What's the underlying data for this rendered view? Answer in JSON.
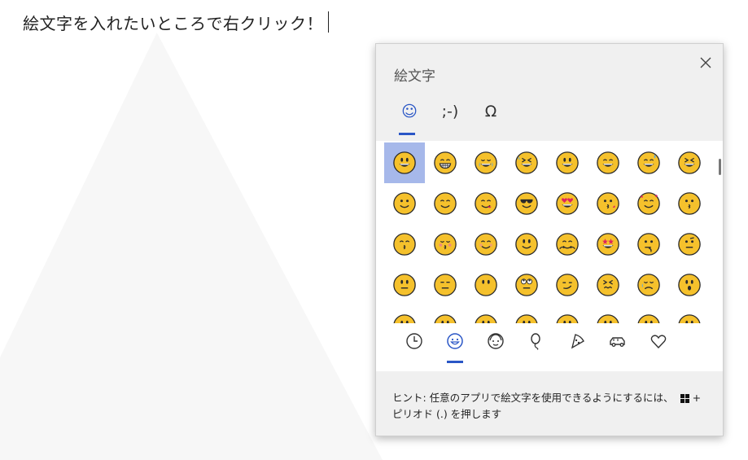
{
  "editor": {
    "text": "絵文字を入れたいところで右クリック！"
  },
  "panel": {
    "title": "絵文字",
    "close_icon": "close-icon",
    "tabs": [
      {
        "id": "emoji",
        "icon": "smiley-tab-icon",
        "label": "☺",
        "active": true
      },
      {
        "id": "kaomoji",
        "icon": "kaomoji-tab-icon",
        "label": ";-)",
        "active": false
      },
      {
        "id": "symbols",
        "icon": "omega-tab-icon",
        "label": "Ω",
        "active": false
      }
    ],
    "emoji_rows": [
      [
        "grinning-face",
        "beaming-face",
        "tears-of-joy-face",
        "rolling-laughing-face",
        "grinning-big-eyes-face",
        "grinning-smiling-eyes-face",
        "sweat-smile-face",
        "squinting-laugh-face"
      ],
      [
        "winking-face",
        "smiling-face",
        "savoring-food-face",
        "sunglasses-face",
        "heart-eyes-face",
        "blowing-kiss-face",
        "hearts-face",
        "kissing-face"
      ],
      [
        "kissing-smiling-eyes-face",
        "kissing-closed-eyes-face",
        "relaxed-face",
        "slightly-smiling-face",
        "hugging-face",
        "star-struck-face",
        "thinking-face",
        "raised-eyebrow-face"
      ],
      [
        "neutral-face",
        "expressionless-face",
        "no-mouth-face",
        "rolling-eyes-face",
        "smirking-face",
        "persevering-face",
        "sad-sweat-face",
        "open-mouth-face"
      ],
      [
        "face-row5-1",
        "face-row5-2",
        "face-row5-3",
        "face-row5-4",
        "face-row5-5",
        "face-row5-6",
        "face-row5-7",
        "face-row5-8"
      ]
    ],
    "selected_emoji": "grinning-face",
    "categories": [
      {
        "id": "recent",
        "icon": "clock-icon",
        "active": false
      },
      {
        "id": "smileys",
        "icon": "smiley-category-icon",
        "active": true
      },
      {
        "id": "people",
        "icon": "person-icon",
        "active": false
      },
      {
        "id": "celebration",
        "icon": "balloon-icon",
        "active": false
      },
      {
        "id": "food",
        "icon": "pizza-icon",
        "active": false
      },
      {
        "id": "travel",
        "icon": "car-icon",
        "active": false
      },
      {
        "id": "symbols",
        "icon": "heart-icon",
        "active": false
      }
    ],
    "hint_line1": "ヒント: 任意のアプリで絵文字を使用できるようにするには、",
    "hint_plus": "+",
    "hint_line2": "ピリオド (.) を押します"
  },
  "colors": {
    "accent": "#2a56c6",
    "selected_bg": "#a6b8ea",
    "emoji_yellow": "#f5c12c",
    "emoji_outline": "#2b2b2b",
    "panel_gray": "#f0f0f0"
  }
}
